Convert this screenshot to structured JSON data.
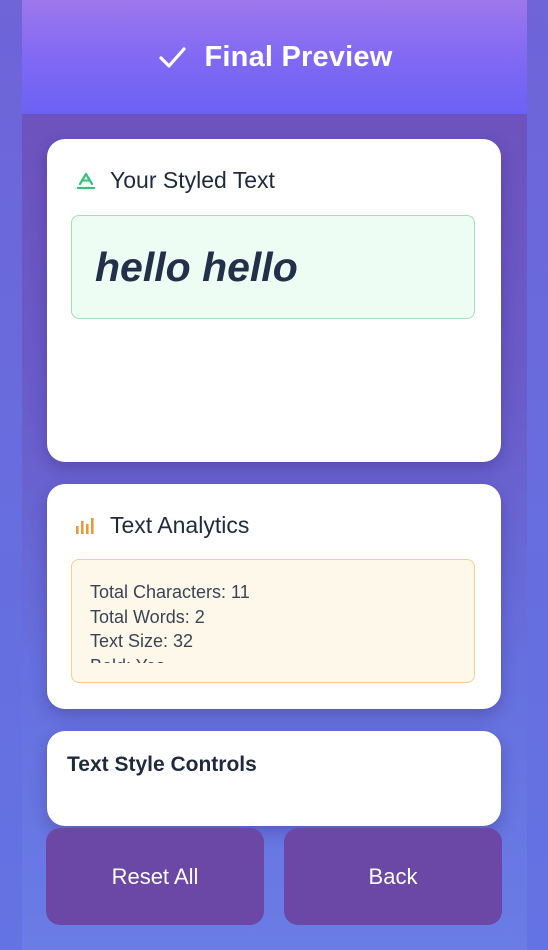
{
  "header": {
    "icon": "check-icon",
    "title": "Final Preview"
  },
  "styled_card": {
    "icon": "text-style-icon",
    "icon_color": "#34c27a",
    "heading": "Your Styled Text",
    "preview_text": "hello hello"
  },
  "analytics_card": {
    "icon": "bar-chart-icon",
    "icon_color": "#e59a3f",
    "heading": "Text Analytics",
    "stats": [
      "Total Characters: 11",
      "Total Words: 2",
      "Text Size: 32",
      "Bold: Yes"
    ]
  },
  "controls_card": {
    "heading": "Text Style Controls"
  },
  "buttons": {
    "reset_label": "Reset All",
    "back_label": "Back"
  },
  "colors": {
    "header_accent": "#7f68f4",
    "button": "#6b48a6",
    "text_dark": "#1f2a3d"
  }
}
